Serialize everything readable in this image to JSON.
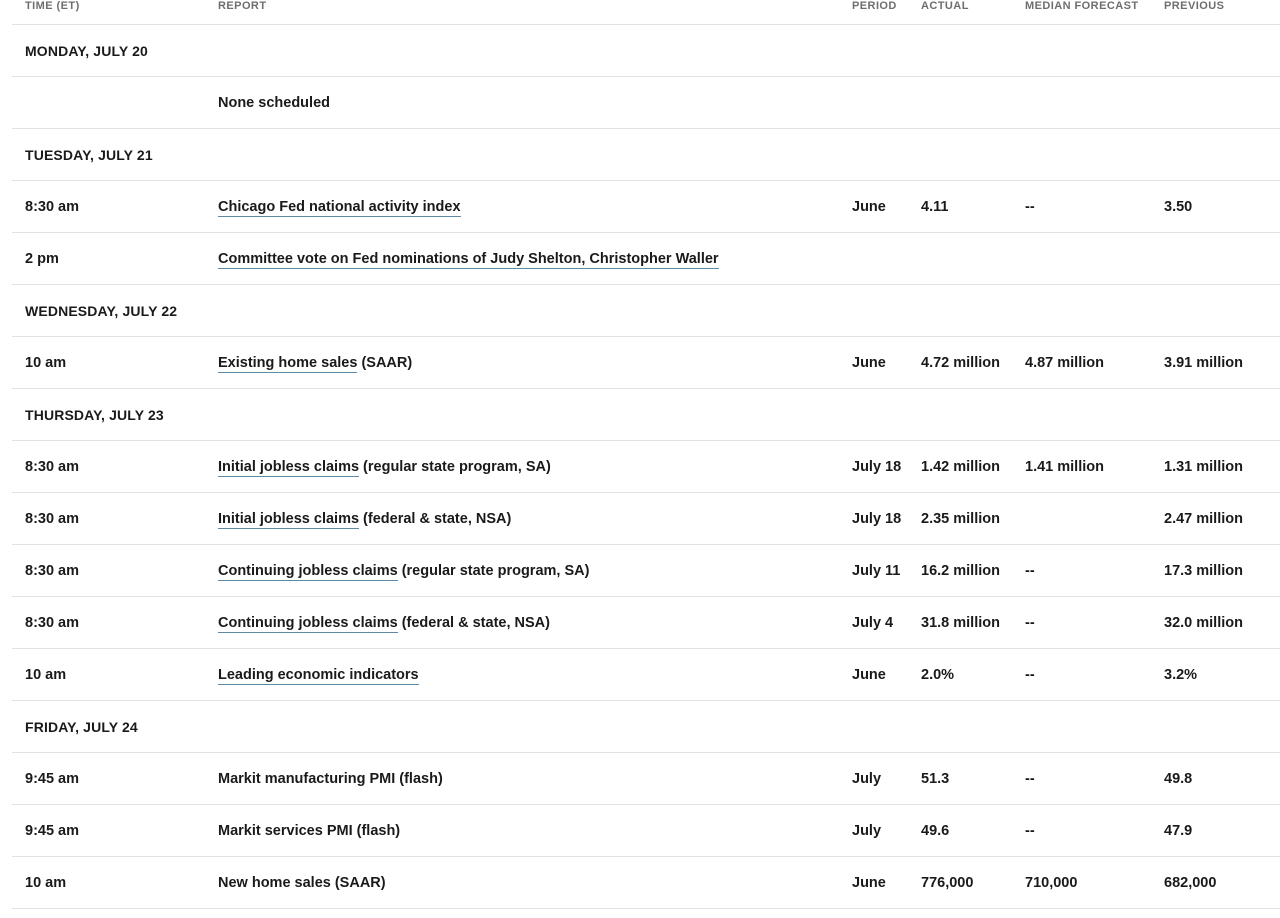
{
  "table": {
    "columns": [
      {
        "key": "time",
        "label": "TIME (ET)"
      },
      {
        "key": "report",
        "label": "REPORT"
      },
      {
        "key": "period",
        "label": "PERIOD"
      },
      {
        "key": "actual",
        "label": "ACTUAL"
      },
      {
        "key": "median",
        "label": "MEDIAN FORECAST"
      },
      {
        "key": "previous",
        "label": "PREVIOUS"
      }
    ],
    "colors": {
      "header_text": "#6e6e6e",
      "body_text": "#1a1a1a",
      "rule": "#e2e2e2",
      "link_underline": "#5f8aa8",
      "background": "#ffffff"
    },
    "rows": [
      {
        "type": "day",
        "day": "MONDAY, JULY 20"
      },
      {
        "type": "data",
        "time": "",
        "report_link": "",
        "report_plain": "None scheduled",
        "period": "",
        "actual": "",
        "median": "",
        "previous": ""
      },
      {
        "type": "day",
        "day": "TUESDAY, JULY 21"
      },
      {
        "type": "data",
        "time": "8:30 am",
        "report_link": "Chicago Fed national activity index",
        "report_plain": "",
        "period": "June",
        "actual": "4.11",
        "median": "--",
        "previous": "3.50"
      },
      {
        "type": "data",
        "time": "2 pm",
        "report_link": "Committee vote on Fed nominations of Judy Shelton, Christopher Waller",
        "report_plain": "",
        "period": "",
        "actual": "",
        "median": "",
        "previous": ""
      },
      {
        "type": "day",
        "day": "WEDNESDAY, JULY 22"
      },
      {
        "type": "data",
        "time": "10 am",
        "report_link": "Existing home sales",
        "report_plain": " (SAAR)",
        "period": "June",
        "actual": "4.72 million",
        "median": "4.87 million",
        "previous": "3.91 million"
      },
      {
        "type": "day",
        "day": "THURSDAY, JULY 23"
      },
      {
        "type": "data",
        "time": "8:30 am",
        "report_link": "Initial jobless claims",
        "report_plain": " (regular state program, SA)",
        "period": "July 18",
        "actual": "1.42 million",
        "median": "1.41 million",
        "previous": "1.31 million"
      },
      {
        "type": "data",
        "time": "8:30 am",
        "report_link": "Initial jobless claims",
        "report_plain": " (federal & state, NSA)",
        "period": "July 18",
        "actual": "2.35 million",
        "median": "",
        "previous": "2.47 million"
      },
      {
        "type": "data",
        "time": "8:30 am",
        "report_link": "Continuing jobless claims",
        "report_plain": " (regular state program, SA)",
        "period": "July 11",
        "actual": "16.2 million",
        "median": "--",
        "previous": "17.3 million"
      },
      {
        "type": "data",
        "time": "8:30 am",
        "report_link": "Continuing jobless claims",
        "report_plain": " (federal & state, NSA)",
        "period": "July 4",
        "actual": "31.8 million",
        "median": "--",
        "previous": "32.0 million"
      },
      {
        "type": "data",
        "time": "10 am",
        "report_link": "Leading economic indicators",
        "report_plain": "",
        "period": "June",
        "actual": "2.0%",
        "median": "--",
        "previous": "3.2%"
      },
      {
        "type": "day",
        "day": "FRIDAY, JULY 24"
      },
      {
        "type": "data",
        "time": "9:45 am",
        "report_link": "",
        "report_plain": "Markit manufacturing PMI (flash)",
        "period": "July",
        "actual": "51.3",
        "median": "--",
        "previous": "49.8"
      },
      {
        "type": "data",
        "time": "9:45 am",
        "report_link": "",
        "report_plain": "Markit services PMI (flash)",
        "period": "July",
        "actual": "49.6",
        "median": "--",
        "previous": "47.9"
      },
      {
        "type": "data",
        "time": "10 am",
        "report_link": "",
        "report_plain": "New home sales (SAAR)",
        "period": "June",
        "actual": "776,000",
        "median": "710,000",
        "previous": "682,000"
      }
    ]
  }
}
